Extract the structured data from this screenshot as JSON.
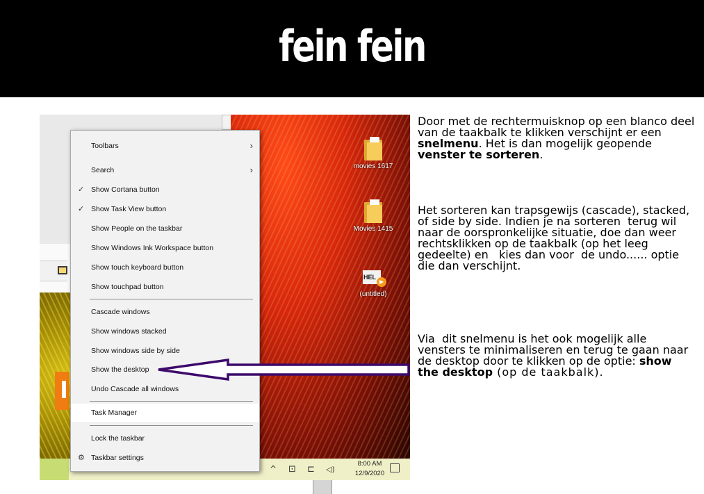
{
  "header": {
    "title": "fein fein"
  },
  "screenshot": {
    "context_menu": {
      "items": [
        {
          "label": "Toolbars",
          "check": "",
          "arrow": "›"
        },
        {
          "label": "Search",
          "check": "",
          "arrow": "›"
        },
        {
          "label": "Show Cortana button",
          "check": "✓",
          "arrow": ""
        },
        {
          "label": "Show Task View button",
          "check": "✓",
          "arrow": ""
        },
        {
          "label": "Show People on the taskbar",
          "check": "",
          "arrow": ""
        },
        {
          "label": "Show Windows Ink Workspace button",
          "check": "",
          "arrow": ""
        },
        {
          "label": "Show touch keyboard button",
          "check": "",
          "arrow": ""
        },
        {
          "label": "Show touchpad button",
          "check": "",
          "arrow": ""
        },
        {
          "label": "Cascade windows",
          "check": "",
          "arrow": ""
        },
        {
          "label": "Show windows stacked",
          "check": "",
          "arrow": ""
        },
        {
          "label": "Show windows side by side",
          "check": "",
          "arrow": ""
        },
        {
          "label": "Show the desktop",
          "check": "",
          "arrow": ""
        },
        {
          "label": "Undo Cascade all windows",
          "check": "",
          "arrow": ""
        },
        {
          "label": "Task Manager",
          "check": "",
          "arrow": ""
        },
        {
          "label": "Lock the taskbar",
          "check": "",
          "arrow": ""
        },
        {
          "label": "Taskbar settings",
          "check": "⚙",
          "arrow": ""
        }
      ]
    },
    "desktop_icons": [
      {
        "label": "movies 1617",
        "icon": "folder-icon"
      },
      {
        "label": "Movies 1415",
        "icon": "folder-icon"
      },
      {
        "label": "(untitled)",
        "icon": "video-file-icon",
        "thumb_text": "HEL"
      }
    ],
    "tray": {
      "chevron": "^",
      "icons": [
        "wifi-icon",
        "network-icon",
        "volume-icon"
      ],
      "icon_glyphs": [
        "⊡",
        "⊏",
        "◁)"
      ],
      "time": "8:00 AM",
      "date": "12/9/2020"
    }
  },
  "explanation": {
    "para1": {
      "text1": "Door met de rechtermuisknop op een blanco deel van de taakbalk te klikken verschijnt er een ",
      "bold1": "snelmenu",
      "text2": ". Het is dan mogelijk geopende ",
      "bold2": "venster te sorteren",
      "text3": "."
    },
    "para2": {
      "text1": "Het sorteren kan trapsgewijs (cascade), stacked, of side by side. Indien je na sorteren  terug wil naar de oorspronkelijke situatie, doe dan weer rechtsklikken op de taakbalk (op het leeg gedeelte) en   kies dan voor  de undo...... optie die dan verschijnt."
    },
    "para3": {
      "text1": "Via  dit snelmenu is het ook mogelijk alle vensters te minimaliseren en terug te gaan naar de desktop door te klikken op de optie: ",
      "bold1": "show the desktop",
      "text2": " (op de taakbalk)."
    }
  },
  "colors": {
    "arrow": "#3d0a6b",
    "header_bg": "#000000",
    "header_text": "#ffffff"
  }
}
